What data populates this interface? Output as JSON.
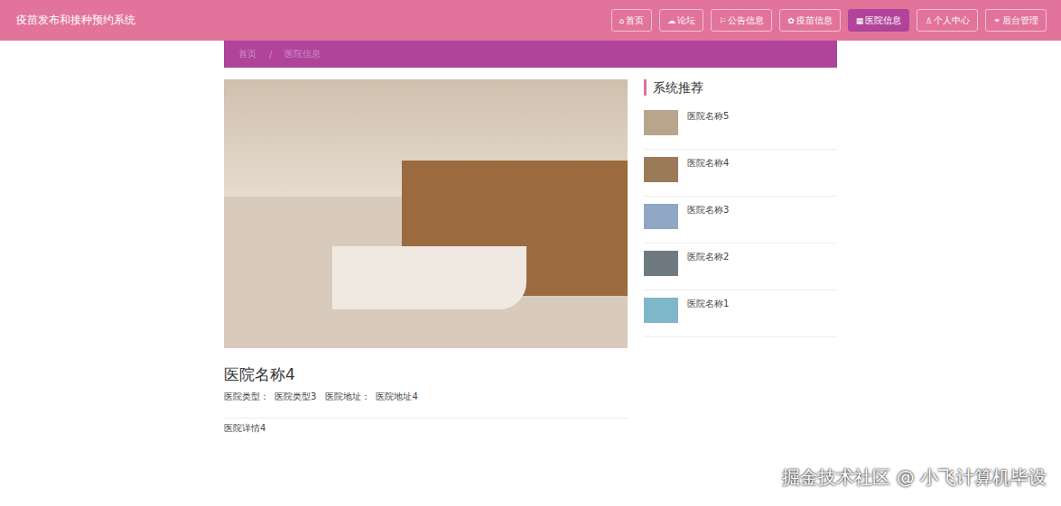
{
  "header": {
    "title": "疫苗发布和接种预约系统"
  },
  "nav": [
    {
      "icon": "⌂",
      "label": "首页",
      "selected": false
    },
    {
      "icon": "☁",
      "label": "论坛",
      "selected": false
    },
    {
      "icon": "⚐",
      "label": "公告信息",
      "selected": false
    },
    {
      "icon": "✿",
      "label": "疫苗信息",
      "selected": false
    },
    {
      "icon": "▦",
      "label": "医院信息",
      "selected": true
    },
    {
      "icon": "♙",
      "label": "个人中心",
      "selected": false
    },
    {
      "icon": "⚭",
      "label": "后台管理",
      "selected": false
    }
  ],
  "breadcrumb": [
    "首页",
    "/",
    "医院信息"
  ],
  "hospital": {
    "name": "医院名称4",
    "fields": [
      {
        "label": "医院类型：",
        "value": "医院类型3"
      },
      {
        "label": "医院地址：",
        "value": "医院地址4"
      }
    ],
    "detail": "医院详情4"
  },
  "recommend": {
    "title": "系统推荐",
    "items": [
      {
        "name": "医院名称5"
      },
      {
        "name": "医院名称4"
      },
      {
        "name": "医院名称3"
      },
      {
        "name": "医院名称2"
      },
      {
        "name": "医院名称1"
      }
    ]
  },
  "watermark": "掘金技术社区 @ 小飞计算机毕设"
}
